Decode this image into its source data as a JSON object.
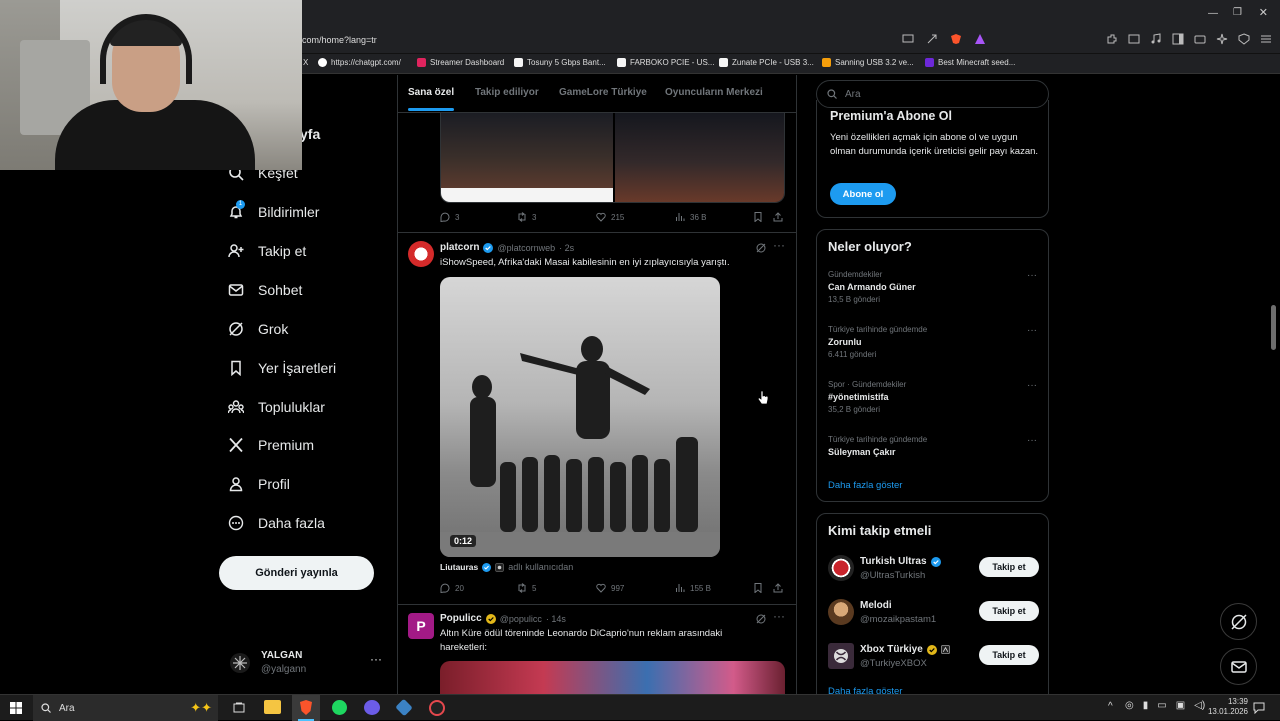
{
  "browser": {
    "url": "com/home?lang=tr",
    "bookmarks": [
      {
        "label": "X",
        "color": "#000000"
      },
      {
        "label": "https://chatgpt.com/",
        "color": "#ffffff"
      },
      {
        "label": "Streamer Dashboard",
        "color": "#e0245e"
      },
      {
        "label": "Tosuny 5 Gbps Bant...",
        "color": "#f5f5f5"
      },
      {
        "label": "FARBOKO PCIE - US...",
        "color": "#f5f5f5"
      },
      {
        "label": "Zunate PCIe - USB 3...",
        "color": "#f5f5f5"
      },
      {
        "label": "Sanning USB 3.2 ve...",
        "color": "#f59e0b"
      },
      {
        "label": "Best Minecraft seed...",
        "color": "#6d28d9"
      }
    ]
  },
  "sidebar": {
    "partial_title": "yfa",
    "items": [
      {
        "label": "Keşfet",
        "icon": "search-icon"
      },
      {
        "label": "Bildirimler",
        "icon": "bell-icon",
        "badge": "1"
      },
      {
        "label": "Takip et",
        "icon": "add-user-icon"
      },
      {
        "label": "Sohbet",
        "icon": "mail-icon"
      },
      {
        "label": "Grok",
        "icon": "grok-icon"
      },
      {
        "label": "Yer İşaretleri",
        "icon": "bookmark-icon"
      },
      {
        "label": "Topluluklar",
        "icon": "people-icon"
      },
      {
        "label": "Premium",
        "icon": "x-logo-icon"
      },
      {
        "label": "Profil",
        "icon": "person-icon"
      },
      {
        "label": "Daha fazla",
        "icon": "more-circle-icon"
      }
    ],
    "post_button": "Gönderi yayınla",
    "account": {
      "name": "YALGAN",
      "handle": "@yalgann",
      "more": "···"
    }
  },
  "feed": {
    "tabs": [
      "Sana özel",
      "Takip ediliyor",
      "GameLore Türkiye",
      "Oyuncuların Merkezi"
    ],
    "active_tab": "Sana özel",
    "post0": {
      "replies": "3",
      "reposts": "3",
      "likes": "215",
      "views": "36 B"
    },
    "post1": {
      "author": "platcorn",
      "handle": "@platcornweb",
      "time": "· 2s",
      "text": "iShowSpeed, Afrika'daki Masai kabilesinin en iyi zıplayıcısıyla yarıştı.",
      "video_duration": "0:12",
      "credit_name": "Liutauras",
      "credit_note": "adlı kullanıcıdan",
      "replies": "20",
      "reposts": "5",
      "likes": "997",
      "views": "155 B"
    },
    "post2": {
      "author": "Populicc",
      "handle": "@populicc",
      "time": "· 14s",
      "text": "Altın Küre ödül töreninde Leonardo DiCaprio'nun reklam arasındaki hareketleri:"
    }
  },
  "right": {
    "search_placeholder": "Ara",
    "premium": {
      "title": "Premium'a Abone Ol",
      "text": "Yeni özellikleri açmak için abone ol ve uygun olman durumunda içerik üreticisi gelir payı kazan.",
      "button": "Abone ol"
    },
    "trends": {
      "title": "Neler oluyor?",
      "items": [
        {
          "category": "Gündemdekiler",
          "name": "Can Armando Güner",
          "count": "13,5 B gönderi"
        },
        {
          "category": "Türkiye tarihinde gündemde",
          "name": "Zorunlu",
          "count": "6.411 gönderi"
        },
        {
          "category": "Spor · Gündemdekiler",
          "name": "#yönetimistifa",
          "count": "35,2 B gönderi"
        },
        {
          "category": "Türkiye tarihinde gündemde",
          "name": "Süleyman Çakır",
          "count": ""
        }
      ],
      "show_more": "Daha fazla göster"
    },
    "who_to_follow": {
      "title": "Kimi takip etmeli",
      "items": [
        {
          "name": "Turkish Ultras",
          "handle": "@UltrasTurkish",
          "button": "Takip et"
        },
        {
          "name": "Melodi",
          "handle": "@mozaikpastam1",
          "button": "Takip et"
        },
        {
          "name": "Xbox Türkiye",
          "handle": "@TurkiyeXBOX",
          "button": "Takip et"
        }
      ],
      "show_more": "Daha fazla göster"
    }
  },
  "taskbar": {
    "search_placeholder": "Ara",
    "time": "13:39",
    "date": "13.01.2026"
  },
  "colors": {
    "accent": "#1d9bf0",
    "verified": "#1d9bf0",
    "gold_verified": "#e2b719"
  }
}
